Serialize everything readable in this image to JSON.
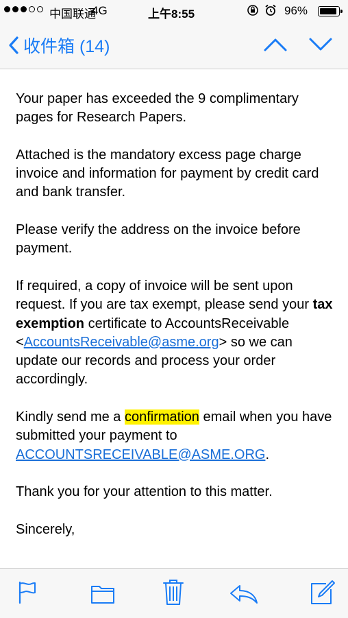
{
  "status_bar": {
    "carrier": "中国联通",
    "network": "4G",
    "time": "上午8:55",
    "battery": "96%",
    "battery_level": 0.96,
    "signal_bars_filled": 3,
    "signal_bars_total": 5
  },
  "nav": {
    "back_label": "收件箱 (14)",
    "accent_color": "#1a7cf6"
  },
  "email": {
    "p1": "Your paper has exceeded the 9 complimentary pages for Research Papers.",
    "p2": "Attached is the mandatory excess page charge invoice and information for payment by credit card and bank transfer.",
    "p3": "Please verify the address on the invoice before payment.",
    "p4_a": "If required, a copy of invoice will be sent upon request. If you are tax exempt, please send your ",
    "p4_bold": "tax exemption",
    "p4_b": " certificate to AccountsReceivable <",
    "p4_link": "AccountsReceivable@asme.org",
    "p4_c": "> so we can update our records and process your order accordingly.",
    "p5_a": "Kindly send me a ",
    "p5_highlight": "confirmation",
    "p5_b": " email when you have submitted your payment to ",
    "p5_link": "ACCOUNTSRECEIVABLE@ASME.ORG",
    "p5_c": ".",
    "p6": "Thank you for your attention to this matter.",
    "p7": "Sincerely,",
    "highlight_color": "#fff200"
  },
  "toolbar": {
    "icons": [
      "flag-icon",
      "folder-icon",
      "trash-icon",
      "reply-icon",
      "compose-icon"
    ]
  }
}
